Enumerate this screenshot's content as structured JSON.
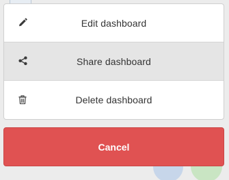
{
  "action_sheet": {
    "items": [
      {
        "label": "Edit dashboard",
        "icon": "pencil-icon",
        "highlighted": false
      },
      {
        "label": "Share dashboard",
        "icon": "share-icon",
        "highlighted": true
      },
      {
        "label": "Delete dashboard",
        "icon": "trash-icon",
        "highlighted": false
      }
    ],
    "cancel_label": "Cancel"
  },
  "colors": {
    "cancel_background": "#e05252",
    "highlight_background": "#e5e5e5",
    "sheet_background": "#ffffff",
    "overlay_background": "#ececec"
  }
}
